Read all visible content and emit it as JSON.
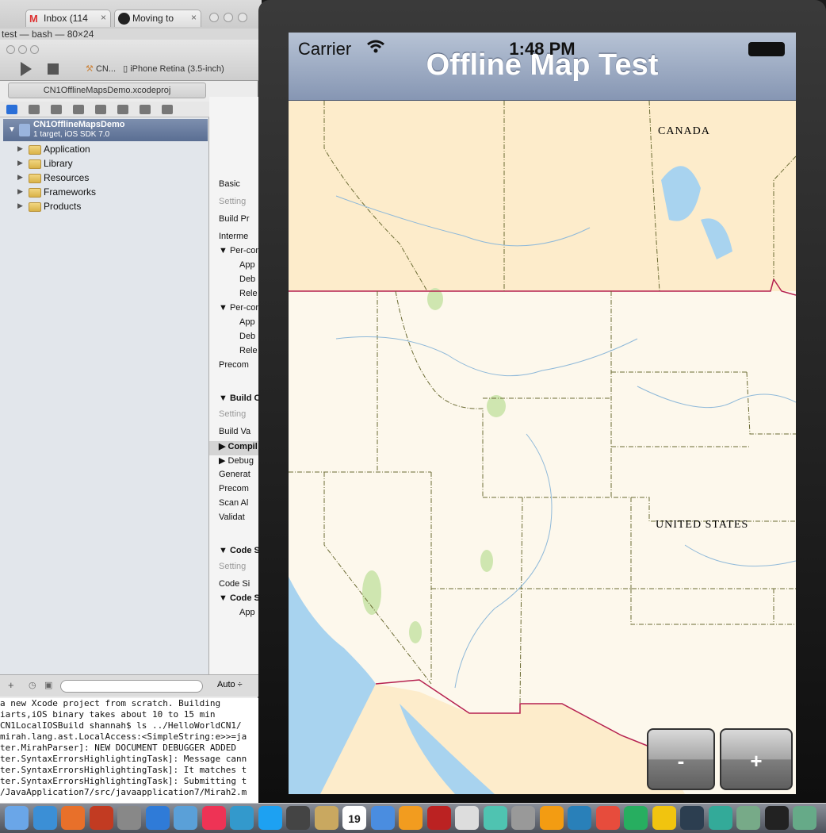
{
  "browser": {
    "tabs": [
      {
        "label": "Inbox (114",
        "icon": "gmail-icon"
      },
      {
        "label": "Moving to",
        "icon": "github-icon"
      }
    ]
  },
  "terminal": {
    "title": "test — bash — 80×24",
    "lines": [
      "  a new Xcode project from scratch.  Building",
      "iarts,iOS binary takes about 10 to 15 min",
      "CN1LocalIOSBuild shannah$ ls ../HelloWorldCN1/",
      "mirah.lang.ast.LocalAccess:<SimpleString:e>>=ja",
      "ter.MirahParser]: NEW DOCUMENT DEBUGGER ADDED",
      "ter.SyntaxErrorsHighlightingTask]: Message cann",
      "ter.SyntaxErrorsHighlightingTask]: It matches t",
      "ter.SyntaxErrorsHighlightingTask]: Submitting t",
      "/JavaApplication7/src/javaapplication7/Mirah2.m"
    ]
  },
  "xcode": {
    "scheme": "CN...",
    "device": "iPhone Retina (3.5-inch)",
    "tab_title": "CN1OfflineMapsDemo.xcodeproj",
    "project": {
      "name": "CN1OfflineMapsDemo",
      "subtitle": "1 target, iOS SDK 7.0"
    },
    "folders": [
      "Application",
      "Library",
      "Resources",
      "Frameworks",
      "Products"
    ],
    "settings_rows": [
      {
        "label": "Basic",
        "style": "normal"
      },
      {
        "label": "Setting",
        "style": "dim"
      },
      {
        "label": "Build Pr",
        "style": "normal"
      },
      {
        "label": "Interme",
        "style": "normal"
      },
      {
        "label": "▼ Per-con",
        "style": "normal"
      },
      {
        "label": "App",
        "style": "indent"
      },
      {
        "label": "Deb",
        "style": "indent"
      },
      {
        "label": "Rele",
        "style": "indent"
      },
      {
        "label": "▼ Per-con",
        "style": "normal"
      },
      {
        "label": "App",
        "style": "indent"
      },
      {
        "label": "Deb",
        "style": "indent"
      },
      {
        "label": "Rele",
        "style": "indent"
      },
      {
        "label": "Precom",
        "style": "normal"
      },
      {
        "label": "▼ Build C",
        "style": "hdr"
      },
      {
        "label": "Setting",
        "style": "dim"
      },
      {
        "label": "Build Va",
        "style": "normal"
      },
      {
        "label": "▶ Compil",
        "style": "sel"
      },
      {
        "label": "▶ Debug",
        "style": "normal"
      },
      {
        "label": "Generat",
        "style": "normal"
      },
      {
        "label": "Precom",
        "style": "normal"
      },
      {
        "label": "Scan Al",
        "style": "normal"
      },
      {
        "label": "Validat",
        "style": "normal"
      },
      {
        "label": "▼ Code S",
        "style": "hdr"
      },
      {
        "label": "Setting",
        "style": "dim"
      },
      {
        "label": "Code Si",
        "style": "normal"
      },
      {
        "label": "▼ Code S",
        "style": "hdr"
      },
      {
        "label": "App",
        "style": "indent"
      }
    ],
    "bottom_label": "Auto ÷"
  },
  "simulator": {
    "status": {
      "carrier": "Carrier",
      "time": "1:48 PM"
    },
    "title": "Offline Map Test",
    "map_labels": {
      "canada": "CANADA",
      "us": "UNITED STATES"
    },
    "zoom_out_label": "-",
    "zoom_in_label": "+",
    "colors": {
      "land_canada": "#fdeccb",
      "land_us": "#fdf8ec",
      "water": "#a8d3ef",
      "parks": "#cfe6b0",
      "border": "#b5204f"
    }
  },
  "dock": {
    "items": [
      "finder-icon",
      "safari-icon",
      "firefox-icon",
      "filezilla-icon",
      "scissors-icon",
      "intellij-icon",
      "workbench-icon",
      "java-icon",
      "sequel-icon",
      "skype-icon",
      "camera-icon",
      "address-book-icon",
      "calendar-icon",
      "itunes-icon",
      "ibooks-icon",
      "photo-booth-icon",
      "no-entry-icon",
      "m-icon",
      "preferences-icon",
      "u-icon",
      "w-icon",
      "p-icon",
      "x-icon",
      "o-icon",
      "l-icon",
      "network-icon",
      "preview-icon",
      "terminal-icon",
      "iphoto-icon"
    ],
    "calendar_day": "19"
  }
}
